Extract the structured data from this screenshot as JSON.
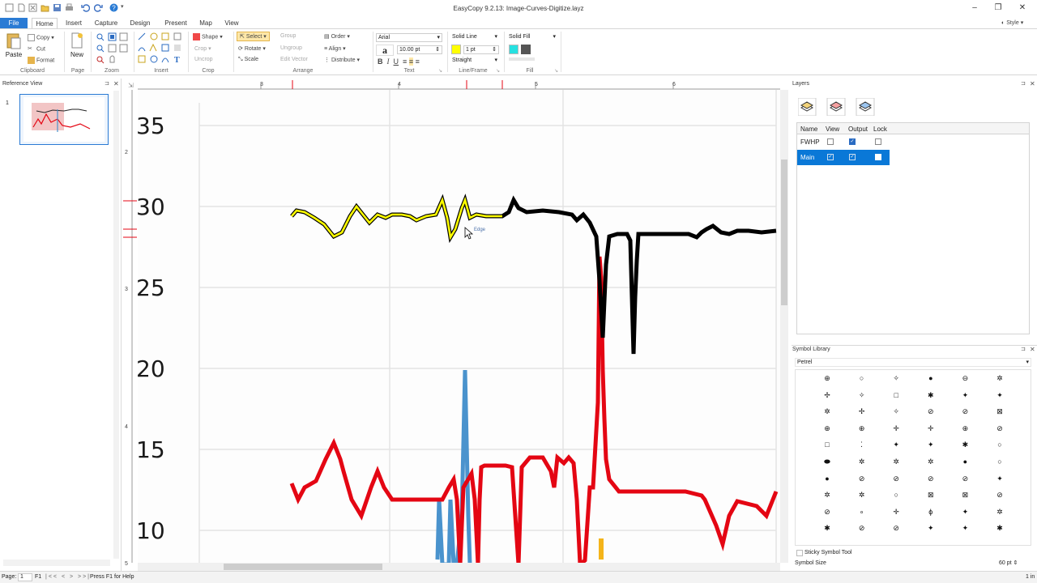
{
  "window": {
    "title": "EasyCopy 9.2.13: Image-Curves-Digitize.layz"
  },
  "tabs": [
    {
      "label": "File"
    },
    {
      "label": "Home"
    },
    {
      "label": "Insert"
    },
    {
      "label": "Capture"
    },
    {
      "label": "Design"
    },
    {
      "label": "Present"
    },
    {
      "label": "Map"
    },
    {
      "label": "View"
    }
  ],
  "style_menu": "Style",
  "ribbon": {
    "clipboard": {
      "paste": "Paste",
      "copy": "Copy",
      "cut": "Cut",
      "format": "Format",
      "label": "Clipboard"
    },
    "page": {
      "new": "New",
      "label": "Page"
    },
    "zoom": {
      "label": "Zoom"
    },
    "insert": {
      "label": "Insert"
    },
    "crop": {
      "shape": "Shape",
      "crop": "Crop",
      "label": "Crop"
    },
    "arrange": {
      "select": "Select",
      "group": "Group",
      "ungroup": "Ungroup",
      "edit_vector": "Edit Vector",
      "rotate": "Rotate",
      "scale": "Scale",
      "uncrop": "Uncrop",
      "order": "Order",
      "align": "Align",
      "distribute": "Distribute",
      "label": "Arrange"
    },
    "text": {
      "font": "Arial",
      "size": "10.00 pt",
      "label": "Text"
    },
    "line": {
      "style": "Solid Line",
      "width": "1 pt",
      "type": "Straight",
      "label": "Line/Frame",
      "color": "#ffff00"
    },
    "fill": {
      "style": "Solid Fill",
      "label": "Fill",
      "color": "#27e1e1"
    }
  },
  "reference_view": {
    "title": "Reference View",
    "page_number": "1"
  },
  "canvas": {
    "ruler_top": [
      "3",
      "4",
      "5",
      "6"
    ],
    "ruler_left": [
      "2",
      "3",
      "4",
      "5"
    ],
    "y_labels": [
      "35",
      "30",
      "25",
      "20",
      "15",
      "10"
    ],
    "tooltip": "Edge",
    "colors": {
      "black": "#000000",
      "yellow": "#ffff00",
      "red": "#e40613",
      "blue": "#4a93cd",
      "orange": "#f4b41a"
    }
  },
  "layers": {
    "title": "Layers",
    "columns": [
      "Name",
      "View",
      "Output",
      "Lock"
    ],
    "rows": [
      {
        "name": "FWHP",
        "view": false,
        "output": true,
        "lock": false
      },
      {
        "name": "Main",
        "view": true,
        "output": true,
        "lock": false,
        "selected": true
      }
    ]
  },
  "symbol_library": {
    "title": "Symbol Library",
    "category": "Petrel",
    "sticky_label": "Sticky Symbol Tool",
    "size_label": "Symbol Size",
    "size_value": "60 pt",
    "symbols": [
      "⊕",
      "○",
      "✧",
      "●",
      "⊖",
      "✲",
      "✢",
      "✧",
      "□",
      "✱",
      "✦",
      "✦",
      "✲",
      "✢",
      "✧",
      "⊘",
      "⊘",
      "⊠",
      "⊕",
      "⊕",
      "✛",
      "✛",
      "⊕",
      "⊘",
      "□",
      "⁚",
      "✦",
      "✦",
      "✱",
      "○",
      "⬬",
      "✲",
      "✲",
      "✲",
      "●",
      "○",
      "●",
      "⊘",
      "⊘",
      "⊘",
      "⊘",
      "✦",
      "✲",
      "✲",
      "○",
      "⊠",
      "⊠",
      "⊘",
      "⊘",
      "∘",
      "✛",
      "ϕ",
      "✦",
      "✲",
      "✱",
      "⊘",
      "⊘",
      "✦",
      "✦",
      "✱"
    ]
  },
  "status": {
    "page": "Page:",
    "page_value": "1",
    "of": "F1",
    "help": "Press F1 for Help",
    "unit": "1 in"
  }
}
